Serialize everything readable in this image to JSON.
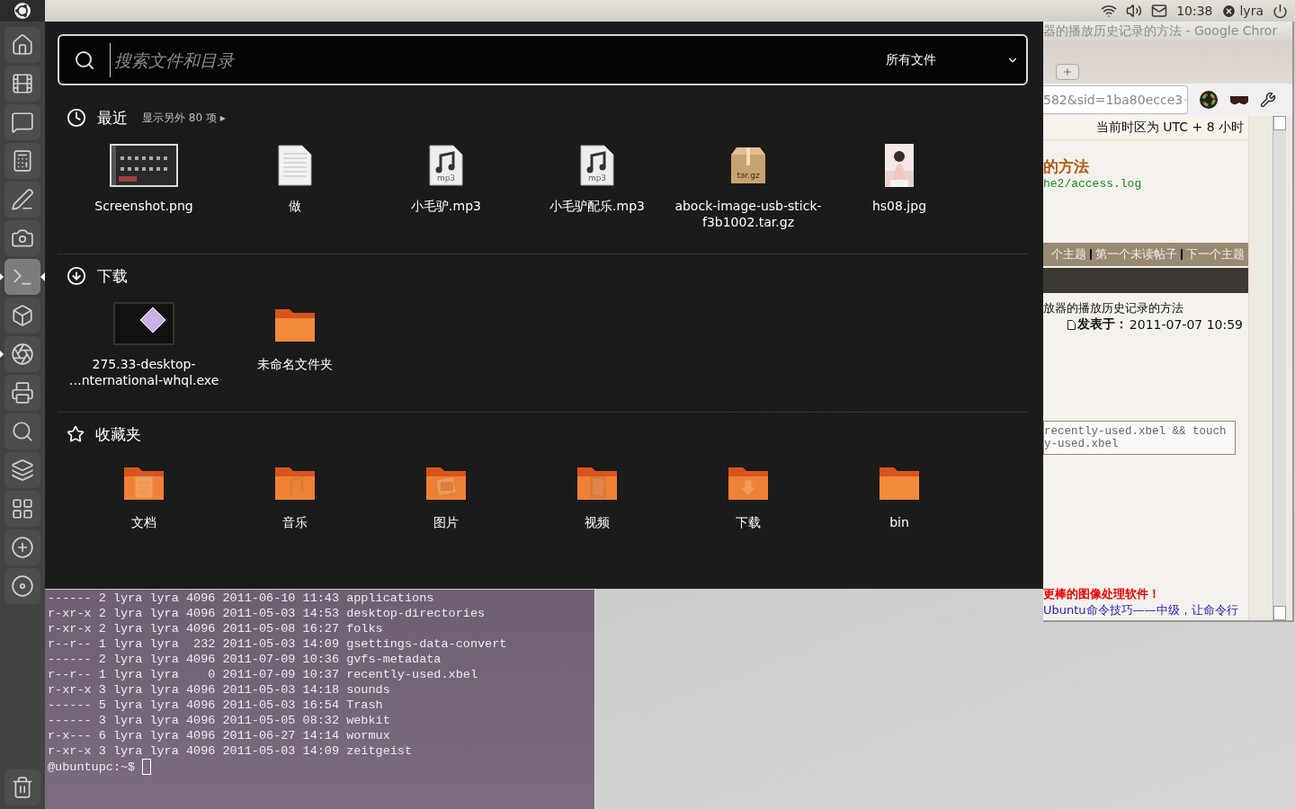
{
  "top_panel": {
    "clock": "10:38",
    "user": "lyra"
  },
  "launcher": {
    "items": [
      {
        "kind": "home",
        "running": false,
        "focused": false
      },
      {
        "kind": "media",
        "running": false,
        "focused": false
      },
      {
        "kind": "chat",
        "running": false,
        "focused": false
      },
      {
        "kind": "calculator",
        "running": false,
        "focused": false
      },
      {
        "kind": "editor",
        "running": false,
        "focused": false
      },
      {
        "kind": "camera",
        "running": false,
        "focused": false
      },
      {
        "kind": "terminal",
        "running": true,
        "focused": true
      },
      {
        "kind": "cube",
        "running": false,
        "focused": false
      },
      {
        "kind": "browser",
        "running": true,
        "focused": false
      },
      {
        "kind": "scanner",
        "running": false,
        "focused": false
      },
      {
        "kind": "search",
        "running": false,
        "focused": false
      },
      {
        "kind": "layers",
        "running": false,
        "focused": false
      },
      {
        "kind": "workspaces",
        "running": false,
        "focused": false
      },
      {
        "kind": "add",
        "running": false,
        "focused": false
      },
      {
        "kind": "disk",
        "running": false,
        "focused": false
      },
      {
        "kind": "trash",
        "running": false,
        "focused": false
      }
    ]
  },
  "dash": {
    "search": {
      "placeholder": "搜索文件和目录"
    },
    "filter": "所有文件",
    "sections": [
      {
        "kind": "recent",
        "title": "最近",
        "more": "显示另外 80 项",
        "more_arrow": "▸",
        "items": [
          {
            "kind": "screenshot",
            "label": "Screenshot.png"
          },
          {
            "kind": "text",
            "label": "做"
          },
          {
            "kind": "audio",
            "label": "小毛驴.mp3",
            "badge": "mp3"
          },
          {
            "kind": "audio",
            "label": "小毛驴配乐.mp3",
            "badge": "mp3"
          },
          {
            "kind": "archive",
            "label": "abock-image-usb-stick-\nf3b1002.tar.gz",
            "badge": "tar.gz"
          },
          {
            "label": "hs08.jpg"
          }
        ]
      },
      {
        "kind": "downloads",
        "title": "下载",
        "items": [
          {
            "kind": "executable",
            "label": "275.33-desktop-\n…nternational-whql.exe"
          },
          {
            "kind": "folder",
            "label": "未命名文件夹"
          }
        ]
      },
      {
        "kind": "favorites",
        "title": "收藏夹",
        "items": [
          {
            "kind": "folder-document",
            "label": "文档"
          },
          {
            "kind": "folder-music",
            "label": "音乐"
          },
          {
            "kind": "folder-picture",
            "label": "图片"
          },
          {
            "kind": "folder-video",
            "label": "视频"
          },
          {
            "kind": "folder-download",
            "label": "下载"
          },
          {
            "kind": "folder",
            "label": "bin"
          }
        ]
      }
    ]
  },
  "terminal": {
    "lines": [
      "------ 2 lyra lyra 4096 2011-06-10 11:43 applications",
      "r-xr-x 2 lyra lyra 4096 2011-05-03 14:53 desktop-directories",
      "r-xr-x 2 lyra lyra 4096 2011-05-08 16:27 folks",
      "r--r-- 1 lyra lyra  232 2011-05-03 14:09 gsettings-data-convert",
      "------ 2 lyra lyra 4096 2011-07-09 10:36 gvfs-metadata",
      "r--r-- 1 lyra lyra    0 2011-07-09 10:37 recently-used.xbel",
      "r-xr-x 3 lyra lyra 4096 2011-05-03 14:18 sounds",
      "------ 5 lyra lyra 4096 2011-05-03 16:54 Trash",
      "------ 3 lyra lyra 4096 2011-05-05 08:32 webkit",
      "r-x--- 6 lyra lyra 4096 2011-06-27 14:14 wormux",
      "r-xr-x 3 lyra lyra 4096 2011-05-03 14:09 zeitgeist"
    ],
    "prompt": "@ubuntupc:~$"
  },
  "browser": {
    "title": "器的播放历史记录的方法 - Google Chror",
    "url": "582&sid=1ba80ecce3",
    "timezone": "当前时区为 UTC + 8 小时",
    "topic_title": "的方法",
    "code_hint": "he2/access.log",
    "nav_links": [
      "个主题",
      "第一个未读帖子",
      "下一个主题"
    ],
    "post_title": "放器的播放历史记录的方法",
    "posted_label": "发表于：",
    "posted_at": "2011-07-07 10:59",
    "code_lines": [
      "recently-used.xbel && touch",
      "y-used.xbel"
    ],
    "promo_lines": [
      {
        "kind": "highlight",
        "text": "更棒的图像处理软件！"
      },
      {
        "kind": "link",
        "text": "Ubuntu命令技巧——中级，让命令行"
      }
    ]
  }
}
